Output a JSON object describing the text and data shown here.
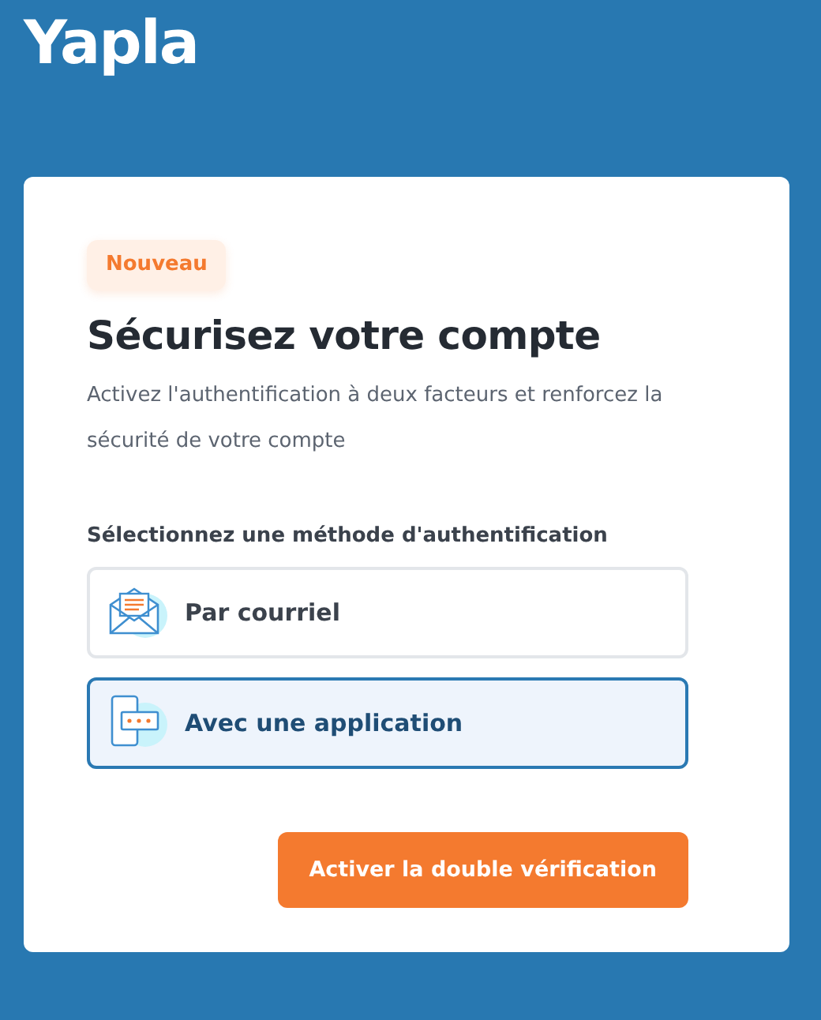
{
  "logo": "Yapla",
  "badge": "Nouveau",
  "title": "Sécurisez votre compte",
  "description": "Activez l'authentification à deux facteurs et renforcez la sécurité de votre compte",
  "methods_label": "Sélectionnez une méthode d'authentification",
  "methods": [
    {
      "kind": "email",
      "label": "Par courriel",
      "selected": false
    },
    {
      "kind": "app",
      "label": "Avec une application",
      "selected": true
    }
  ],
  "submit_button": "Activer la double vérification"
}
